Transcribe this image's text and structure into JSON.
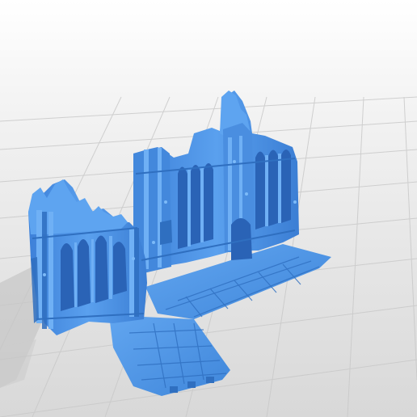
{
  "viewer": {
    "background_color": "#ffffff",
    "floor_color": "#d4d4d4",
    "grid_color": "#c2c2c2",
    "shadow_color": "#bdbdbd"
  },
  "model": {
    "subject": "gothic-ruin-terrain-piece",
    "color_main": "#4a8ee0",
    "color_light": "#6fb0f5",
    "color_dark": "#2f6fc0",
    "color_shadow": "#1f4f95"
  }
}
